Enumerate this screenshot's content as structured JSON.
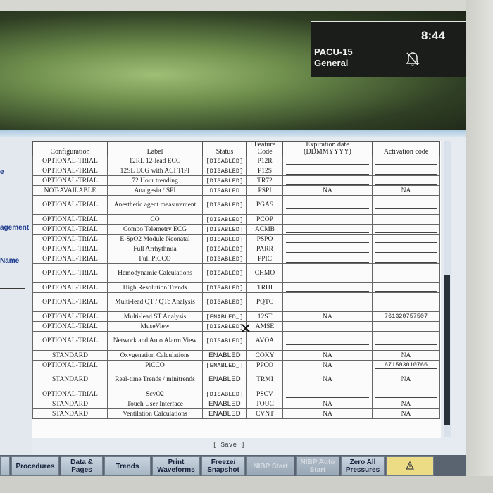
{
  "header": {
    "bed_name": "PACU-15",
    "profile": "General",
    "clock": "8:44",
    "alarm_icon": "alarm-silenced-icon"
  },
  "left_nav": {
    "item1": "e",
    "item2": "agement",
    "item3": "Name"
  },
  "table": {
    "headers": {
      "configuration": "Configuration",
      "label": "Label",
      "status": "Status",
      "feature_code": "Feature Code",
      "expiration": "Expiration date (DDMMYYYY)",
      "activation": "Activation code"
    },
    "rows": [
      {
        "config": "OPTIONAL-TRIAL",
        "label": "12RL 12-lead ECG",
        "status": "[DISABLED]",
        "code": "P12R",
        "exp": "",
        "act": ""
      },
      {
        "config": "OPTIONAL-TRIAL",
        "label": "12SL ECG with ACI TIPI",
        "status": "[DISABLED]",
        "code": "P12S",
        "exp": "",
        "act": ""
      },
      {
        "config": "OPTIONAL-TRIAL",
        "label": "72 Hour trending",
        "status": "[DISABLED]",
        "code": "TR72",
        "exp": "",
        "act": ""
      },
      {
        "config": "NOT-AVAILABLE",
        "label": "Analgesia / SPI",
        "status": "DISABLED",
        "code": "PSPI",
        "exp": "NA",
        "act": "NA"
      },
      {
        "config": "OPTIONAL-TRIAL",
        "label": "Anesthetic agent measurement",
        "status": "[DISABLED]",
        "code": "PGAS",
        "exp": "",
        "act": ""
      },
      {
        "config": "OPTIONAL-TRIAL",
        "label": "CO",
        "status": "[DISABLED]",
        "code": "PCOP",
        "exp": "",
        "act": ""
      },
      {
        "config": "OPTIONAL-TRIAL",
        "label": "Combo Telemetry ECG",
        "status": "[DISABLED]",
        "code": "ACMB",
        "exp": "",
        "act": ""
      },
      {
        "config": "OPTIONAL-TRIAL",
        "label": "E-SpO2 Module Neonatal",
        "status": "[DISABLED]",
        "code": "PSPO",
        "exp": "",
        "act": ""
      },
      {
        "config": "OPTIONAL-TRIAL",
        "label": "Full Arrhythmia",
        "status": "[DISABLED]",
        "code": "PARR",
        "exp": "",
        "act": ""
      },
      {
        "config": "OPTIONAL-TRIAL",
        "label": "Full PiCCO",
        "status": "[DISABLED]",
        "code": "PPIC",
        "exp": "",
        "act": ""
      },
      {
        "config": "OPTIONAL-TRIAL",
        "label": "Hemodynamic Calculations",
        "status": "[DISABLED]",
        "code": "CHMO",
        "exp": "",
        "act": ""
      },
      {
        "config": "OPTIONAL-TRIAL",
        "label": "High Resolution Trends",
        "status": "[DISABLED]",
        "code": "TRHI",
        "exp": "",
        "act": ""
      },
      {
        "config": "OPTIONAL-TRIAL",
        "label": "Multi-lead QT / QTc Analysis",
        "status": "[DISABLED]",
        "code": "PQTC",
        "exp": "",
        "act": ""
      },
      {
        "config": "OPTIONAL-TRIAL",
        "label": "Multi-lead ST Analysis",
        "status": "[ENABLED_]",
        "code": "12ST",
        "exp": "NA",
        "act": "761320757507"
      },
      {
        "config": "OPTIONAL-TRIAL",
        "label": "MuseView",
        "status": "[DISABLED]",
        "code": "AMSE",
        "exp": "",
        "act": ""
      },
      {
        "config": "OPTIONAL-TRIAL",
        "label": "Network and Auto Alarm View",
        "status": "[DISABLED]",
        "code": "AVOA",
        "exp": "",
        "act": ""
      },
      {
        "config": "STANDARD",
        "label": "Oxygenation Calculations",
        "status": "ENABLED",
        "code": "COXY",
        "exp": "NA",
        "act": "NA"
      },
      {
        "config": "OPTIONAL-TRIAL",
        "label": "PiCCO",
        "status": "[ENABLED_]",
        "code": "PPCO",
        "exp": "NA",
        "act": "671503010766"
      },
      {
        "config": "STANDARD",
        "label": "Real-time Trends / minitrends",
        "status": "ENABLED",
        "code": "TRMI",
        "exp": "NA",
        "act": "NA"
      },
      {
        "config": "OPTIONAL-TRIAL",
        "label": "ScvO2",
        "status": "[DISABLED]",
        "code": "PSCV",
        "exp": "",
        "act": ""
      },
      {
        "config": "STANDARD",
        "label": "Touch User Interface",
        "status": "ENABLED",
        "code": "TOUC",
        "exp": "NA",
        "act": "NA"
      },
      {
        "config": "STANDARD",
        "label": "Ventilation Calculations",
        "status": "ENABLED",
        "code": "CVNT",
        "exp": "NA",
        "act": "NA"
      }
    ]
  },
  "save_label": "[ Save ]",
  "softkeys": [
    {
      "label": "Procedures"
    },
    {
      "label": "Data & Pages"
    },
    {
      "label": "Trends"
    },
    {
      "label": "Print Waveforms"
    },
    {
      "label": "Freeze/ Snapshot"
    },
    {
      "label": "NIBP Start"
    },
    {
      "label": "NIBP Auto Start"
    },
    {
      "label": "Zero All Pressures"
    },
    {
      "label": ""
    }
  ]
}
